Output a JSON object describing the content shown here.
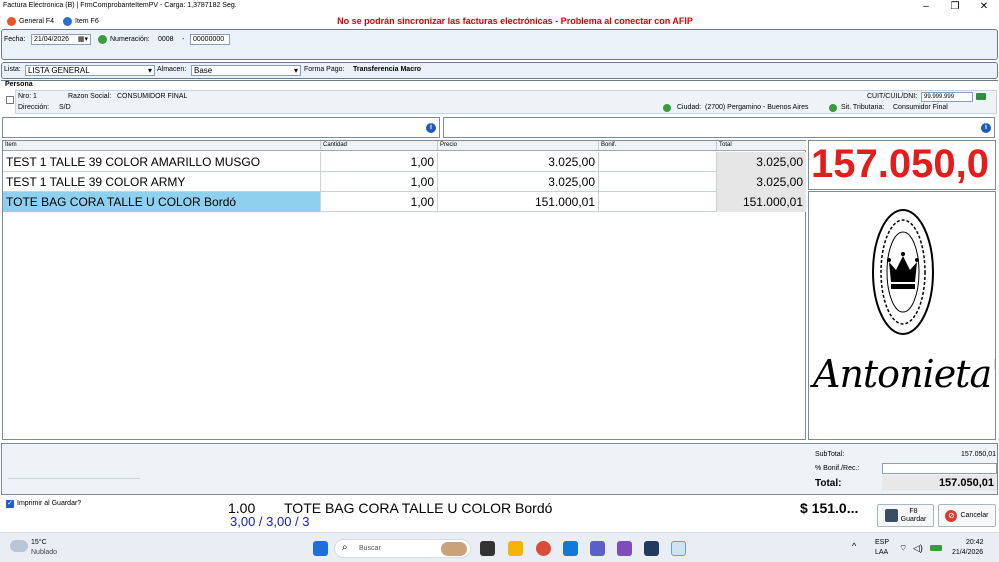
{
  "window": {
    "title": "Factura Electronica (B) | FrmComprobanteItemPV - Carga: 1,3787182 Seg.",
    "minimize": "–",
    "maximize": "❐",
    "close": "✕"
  },
  "menu": {
    "general": "General F4",
    "item": "Item F6"
  },
  "error_message": "No se podrán sincronizar las facturas electrónicas - Problema al conectar con AFIP",
  "header": {
    "fecha_label": "Fecha:",
    "fecha_value": "21/04/2026",
    "numeracion_label": "Numeración:",
    "numeracion_prefix": "0008",
    "numeracion_sep": "-",
    "numeracion_number": "00000000"
  },
  "lista": {
    "lista_label": "Lista:",
    "lista_value": "LISTA GENERAL",
    "almacen_label": "Almacen:",
    "almacen_value": "Base",
    "forma_pago_label": "Forma Pago:",
    "forma_pago_value": "Transferencia Macro"
  },
  "persona": {
    "section_label": "Persona",
    "nro_label": "Nro:",
    "nro_value": "1",
    "razon_social_label": "Razon Social:",
    "razon_social_value": "CONSUMIDOR FINAL",
    "cuit_label": "CUIT/CUIL/DNI:",
    "cuit_value": "99.999.999",
    "direccion_label": "Dirección:",
    "direccion_value": "S/D",
    "ciudad_label": "Ciudad:",
    "ciudad_value": "(2700) Pergamino - Buenos Aires",
    "sit_tributaria_label": "Sit. Tributaria:",
    "sit_tributaria_value": "Consumidor Final"
  },
  "grid": {
    "columns": {
      "item": "Item",
      "cantidad": "Cantidad",
      "precio": "Precio",
      "bonif": "Bonif.",
      "total": "Total"
    },
    "rows": [
      {
        "item": "TEST 1 TALLE 39 COLOR AMARILLO MUSGO",
        "cantidad": "1,00",
        "precio": "3.025,00",
        "bonif": "",
        "total": "3.025,00"
      },
      {
        "item": "TEST 1 TALLE 39 COLOR ARMY",
        "cantidad": "1,00",
        "precio": "3.025,00",
        "bonif": "",
        "total": "3.025,00"
      },
      {
        "item": "TOTE BAG CORA TALLE U COLOR Bordó",
        "cantidad": "1,00",
        "precio": "151.000,01",
        "bonif": "",
        "total": "151.000,01"
      }
    ]
  },
  "big_total": "157.050,0",
  "brand": {
    "logo_text": "Antonieta's"
  },
  "summary": {
    "subtotal_label": "SubTotal:",
    "subtotal_value": "157.050,01",
    "bonif_label": "% Bonif./Rec.:",
    "bonif_value": "",
    "total_label": "Total:",
    "total_value": "157.050,01"
  },
  "footer": {
    "imprimir_label": "Imprimir al Guardar?",
    "last_qty": "1.00",
    "last_item": "TOTE BAG CORA TALLE U COLOR Bordó",
    "last_price": "$ 151.0...",
    "counts": "3,00 / 3,00 / 3",
    "guardar_key": "F8",
    "guardar_label": "Guardar",
    "cancelar_label": "Cancelar"
  },
  "taskbar": {
    "weather_temp": "15°C",
    "weather_desc": "Nublado",
    "search_label": "Buscar",
    "lang_top": "ESP",
    "lang_bottom": "LAA",
    "time": "20:42",
    "date": "21/4/2026"
  },
  "colors": {
    "error": "#e00000",
    "big_total": "#e31c1c",
    "selected_row": "#8fd0ee",
    "footer_blue": "#1a1aa6"
  }
}
